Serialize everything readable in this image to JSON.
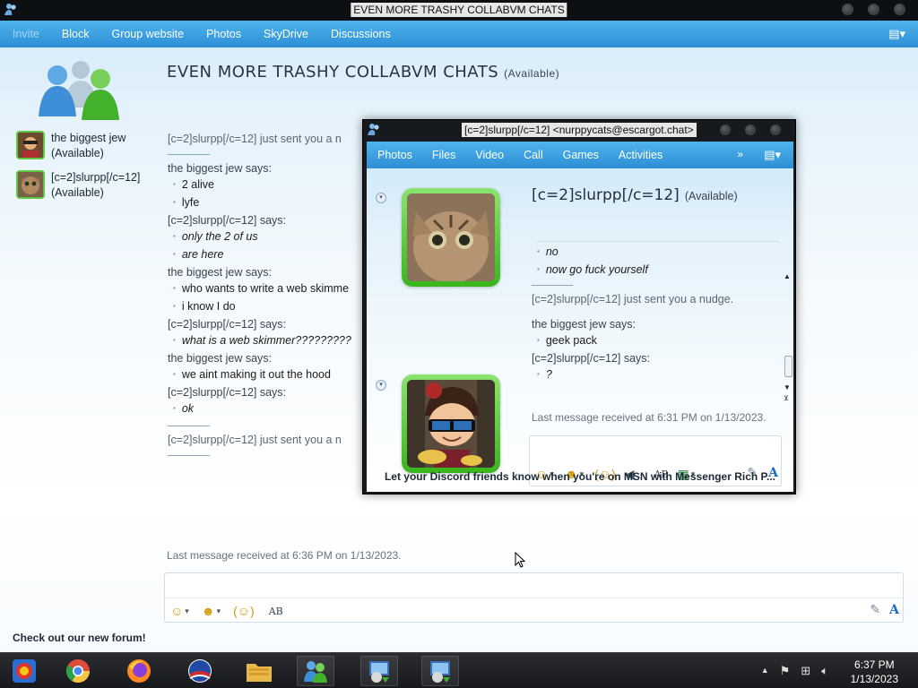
{
  "main": {
    "window_title": "EVEN MORE TRASHY COLLABVM CHATS",
    "menu": [
      "Invite",
      "Block",
      "Group website",
      "Photos",
      "SkyDrive",
      "Discussions"
    ],
    "conversation_title": "EVEN MORE TRASHY COLLABVM CHATS",
    "conversation_status": "(Available)",
    "contacts": [
      {
        "name": "the biggest jew",
        "status": "(Available)"
      },
      {
        "name": "[c=2]slurpp[/c=12]",
        "status": "(Available)"
      }
    ],
    "log": [
      {
        "type": "sys",
        "text": "[c=2]slurpp[/c=12] just sent you a n"
      },
      {
        "type": "hr"
      },
      {
        "type": "says",
        "text": "the biggest jew says:"
      },
      {
        "type": "msg",
        "text": "2 alive"
      },
      {
        "type": "msg",
        "text": "lyfe"
      },
      {
        "type": "says",
        "text": "[c=2]slurpp[/c=12] says:"
      },
      {
        "type": "msg-it",
        "text": "only the 2 of us"
      },
      {
        "type": "msg-it",
        "text": "are here"
      },
      {
        "type": "says",
        "text": "the biggest jew says:"
      },
      {
        "type": "msg",
        "text": "who wants to write a web skimme"
      },
      {
        "type": "msg",
        "text": "i know I do"
      },
      {
        "type": "says",
        "text": "[c=2]slurpp[/c=12] says:"
      },
      {
        "type": "msg-it",
        "text": "what is a web skimmer?????????"
      },
      {
        "type": "says",
        "text": "the biggest jew says:"
      },
      {
        "type": "msg",
        "text": "we aint making it out the hood"
      },
      {
        "type": "says",
        "text": "[c=2]slurpp[/c=12] says:"
      },
      {
        "type": "msg-it",
        "text": "ok"
      },
      {
        "type": "hr"
      },
      {
        "type": "sys",
        "text": "[c=2]slurpp[/c=12] just sent you a n"
      },
      {
        "type": "hr"
      }
    ],
    "last_message": "Last message received at 6:36 PM on 1/13/2023.",
    "forum_link": "Check out our new forum!",
    "ab_label": "AB"
  },
  "popup": {
    "window_title": "[c=2]slurpp[/c=12] <nurppycats@escargot.chat>",
    "menu": [
      "Photos",
      "Files",
      "Video",
      "Call",
      "Games",
      "Activities"
    ],
    "contact_name": "[c=2]slurpp[/c=12]",
    "contact_status": "(Available)",
    "log": [
      {
        "type": "msg-it",
        "text": "no"
      },
      {
        "type": "msg-it",
        "text": "now go fuck yourself"
      },
      {
        "type": "hr"
      },
      {
        "type": "sys",
        "text": "[c=2]slurpp[/c=12] just sent you a nudge."
      },
      {
        "type": "gap"
      },
      {
        "type": "says",
        "text": "the biggest jew says:"
      },
      {
        "type": "msg",
        "text": "geek pack"
      },
      {
        "type": "says",
        "text": "[c=2]slurpp[/c=12] says:"
      },
      {
        "type": "msg-it",
        "text": "?"
      }
    ],
    "last_message": "Last message received at 6:31 PM on 1/13/2023.",
    "banner": "Let your Discord friends know when you're on MSN with Messenger Rich P...",
    "ab_label": "AB"
  },
  "taskbar": {
    "time": "6:37 PM",
    "date": "1/13/2023"
  }
}
